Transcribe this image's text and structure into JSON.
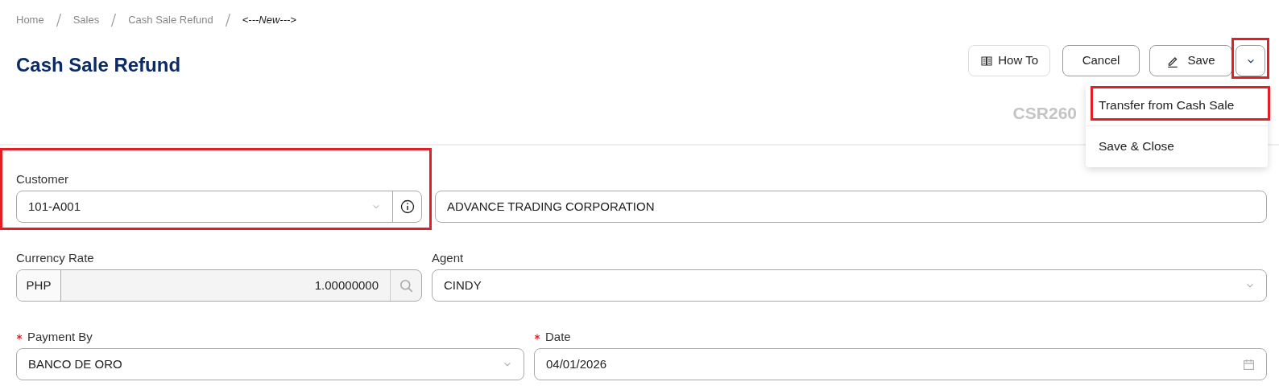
{
  "breadcrumb": [
    {
      "label": "Home",
      "current": false
    },
    {
      "label": "Sales",
      "current": false
    },
    {
      "label": "Cash Sale Refund",
      "current": false
    },
    {
      "label": "<---New--->",
      "current": true
    }
  ],
  "title": "Cash Sale Refund",
  "actions": [
    {
      "kind": "howto",
      "label": "How To",
      "highlighted": false
    },
    {
      "kind": "cancel",
      "label": "Cancel",
      "highlighted": false
    },
    {
      "kind": "save",
      "label": "Save",
      "highlighted": false
    },
    {
      "kind": "more",
      "highlighted": true
    }
  ],
  "menu": {
    "expanded": true,
    "items": [
      {
        "label": "Transfer from Cash Sale",
        "highlighted": true
      },
      {
        "label": "Save & Close",
        "highlighted": false
      }
    ]
  },
  "document_number": "CSR260",
  "customer": {
    "label": "Customer",
    "value": "101-A001",
    "name": "ADVANCE TRADING CORPORATION",
    "highlighted": true
  },
  "currency_rate": {
    "label": "Currency Rate",
    "currency": "PHP",
    "value": "1.00000000"
  },
  "agent": {
    "label": "Agent",
    "value": "CINDY"
  },
  "payment_by": {
    "label": "Payment By",
    "value": "BANCO DE ORO",
    "required": true
  },
  "date": {
    "label": "Date",
    "value": "04/01/2026",
    "required": true
  }
}
